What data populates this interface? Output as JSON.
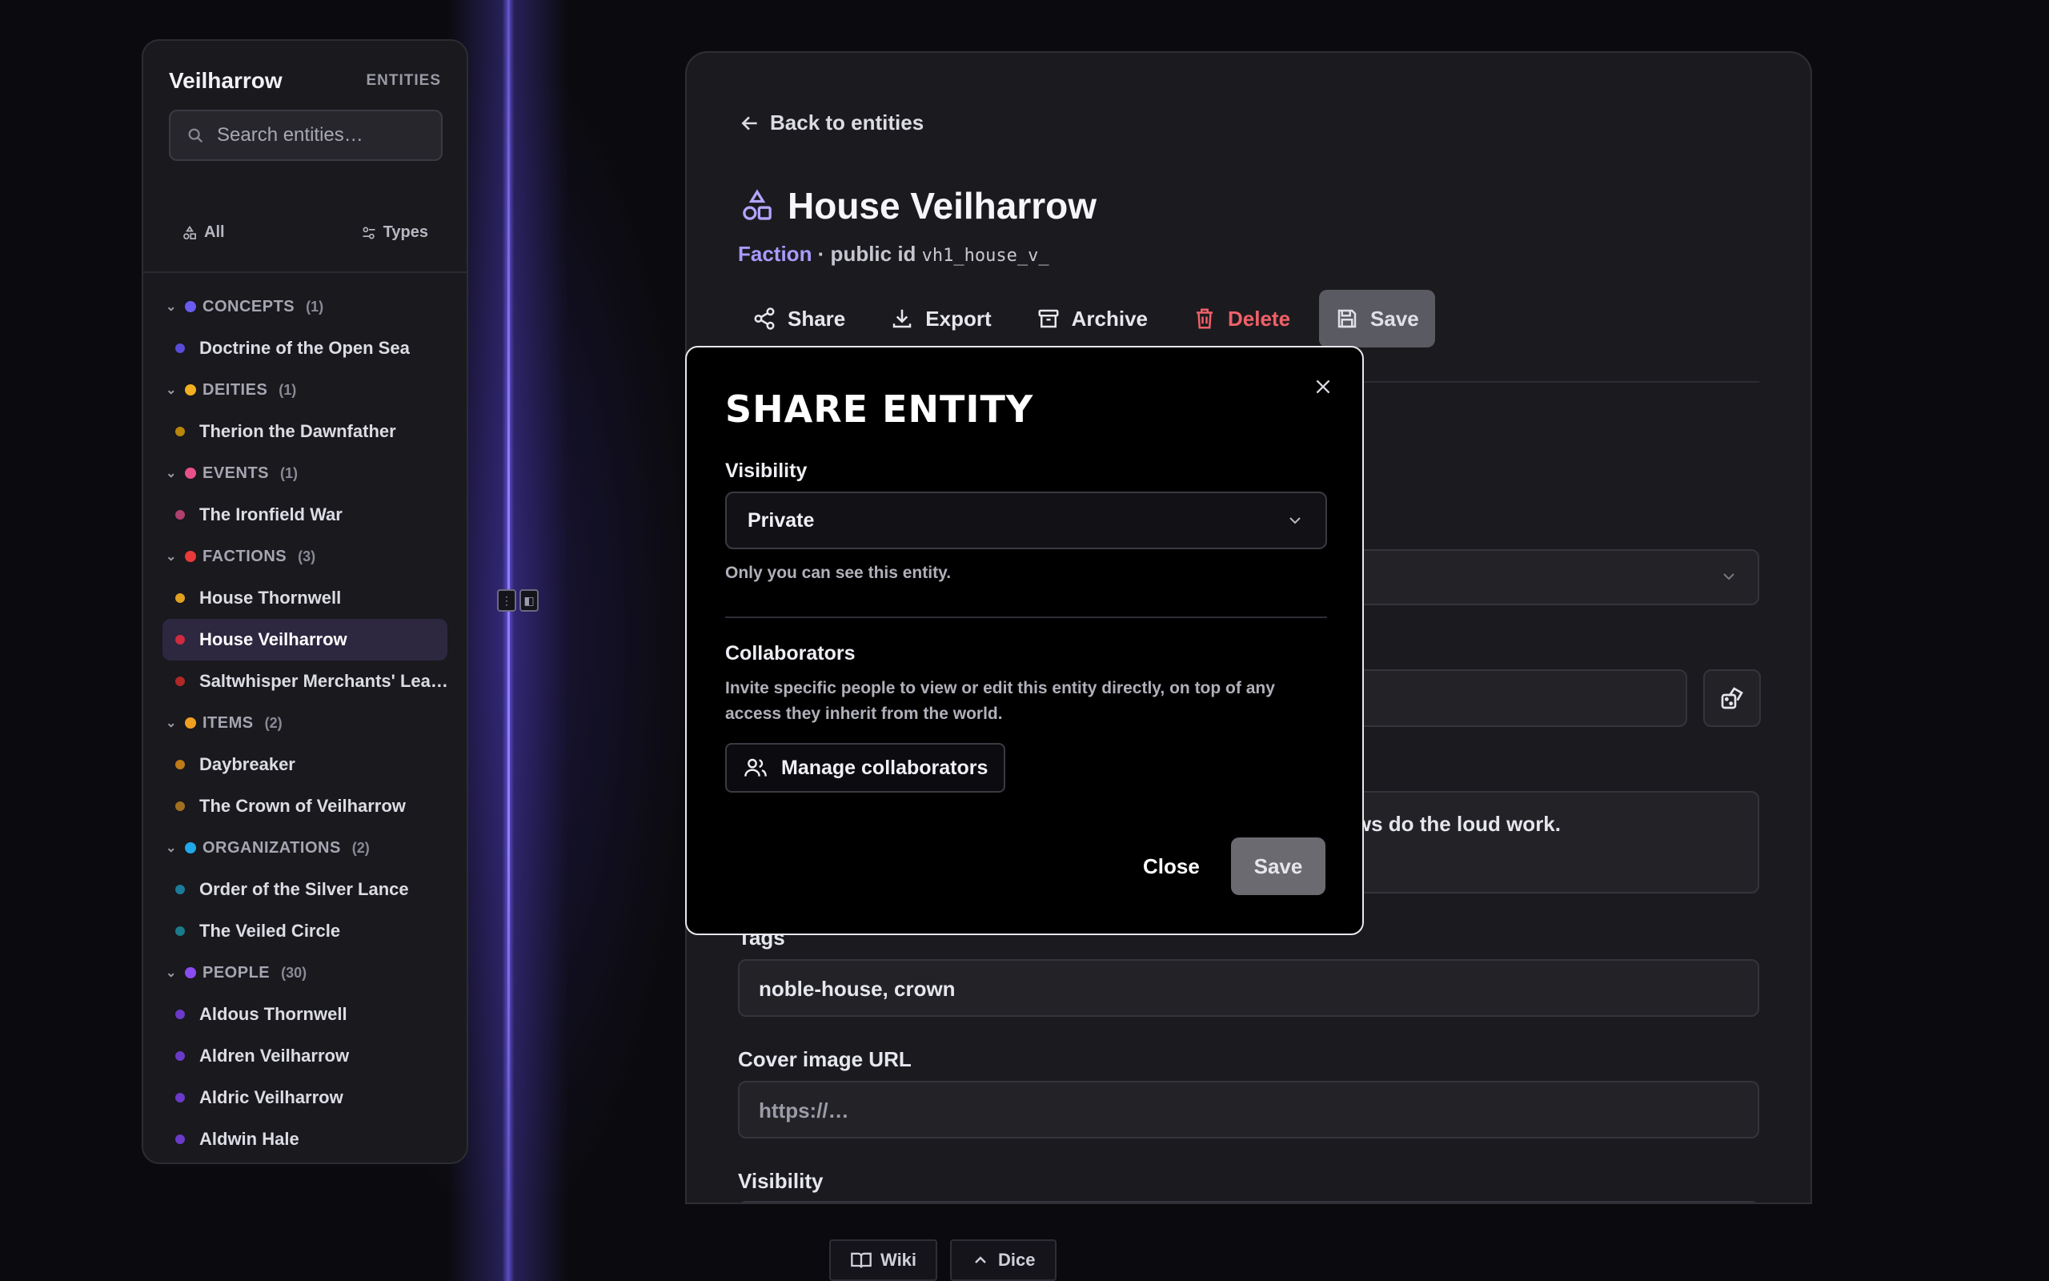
{
  "sidebar": {
    "brand": "Veilharrow",
    "section": "ENTITIES",
    "search_placeholder": "Search entities…",
    "filter_all": "All",
    "filter_types": "Types",
    "groups": [
      {
        "label": "CONCEPTS",
        "count": "(1)",
        "color": "#6a5cf0",
        "items": [
          {
            "label": "Doctrine of the Open Sea",
            "color": "#5a4cd8"
          }
        ]
      },
      {
        "label": "DEITIES",
        "count": "(1)",
        "color": "#f0b020",
        "items": [
          {
            "label": "Therion the Dawnfather",
            "color": "#b8860b"
          }
        ]
      },
      {
        "label": "EVENTS",
        "count": "(1)",
        "color": "#e8508a",
        "items": [
          {
            "label": "The Ironfield War",
            "color": "#b04070"
          }
        ]
      },
      {
        "label": "FACTIONS",
        "count": "(3)",
        "color": "#e83a3a",
        "items": [
          {
            "label": "House Thornwell",
            "color": "#e0a020"
          },
          {
            "label": "House Veilharrow",
            "color": "#d02a40",
            "active": true
          },
          {
            "label": "Saltwhisper Merchants' Lea…",
            "color": "#b02828"
          }
        ]
      },
      {
        "label": "ITEMS",
        "count": "(2)",
        "color": "#f0a020",
        "items": [
          {
            "label": "Daybreaker",
            "color": "#c07a18"
          },
          {
            "label": "The Crown of Veilharrow",
            "color": "#a07020"
          }
        ]
      },
      {
        "label": "ORGANIZATIONS",
        "count": "(2)",
        "color": "#20a8e8",
        "items": [
          {
            "label": "Order of the Silver Lance",
            "color": "#1a7c9a"
          },
          {
            "label": "The Veiled Circle",
            "color": "#1a7c8a"
          }
        ]
      },
      {
        "label": "PEOPLE",
        "count": "(30)",
        "color": "#8a4cf0",
        "items": [
          {
            "label": "Aldous Thornwell",
            "color": "#6a3ac8"
          },
          {
            "label": "Aldren Veilharrow",
            "color": "#6a3ac8"
          },
          {
            "label": "Aldric Veilharrow",
            "color": "#6a3ac8"
          },
          {
            "label": "Aldwin Hale",
            "color": "#6a3ac8"
          }
        ]
      }
    ]
  },
  "main": {
    "back": "Back to entities",
    "title": "House Veilharrow",
    "type": "Faction",
    "meta_sep": " · public id ",
    "public_id": "vh1_house_v_",
    "actions": {
      "share": "Share",
      "export": "Export",
      "archive": "Archive",
      "delete": "Delete",
      "save": "Save"
    },
    "summary_fragment": "ws do the loud work.",
    "tags_label": "Tags",
    "tags_value": "noble-house, crown",
    "cover_label": "Cover image URL",
    "cover_placeholder": "https://…",
    "visibility_label": "Visibility"
  },
  "modal": {
    "title": "SHARE ENTITY",
    "visibility_label": "Visibility",
    "visibility_value": "Private",
    "visibility_help": "Only you can see this entity.",
    "collaborators_label": "Collaborators",
    "collaborators_help": "Invite specific people to view or edit this entity directly, on top of any access they inherit from the world.",
    "manage_button": "Manage collaborators",
    "close_button": "Close",
    "save_button": "Save"
  },
  "bottom": {
    "wiki": "Wiki",
    "dice": "Dice"
  }
}
